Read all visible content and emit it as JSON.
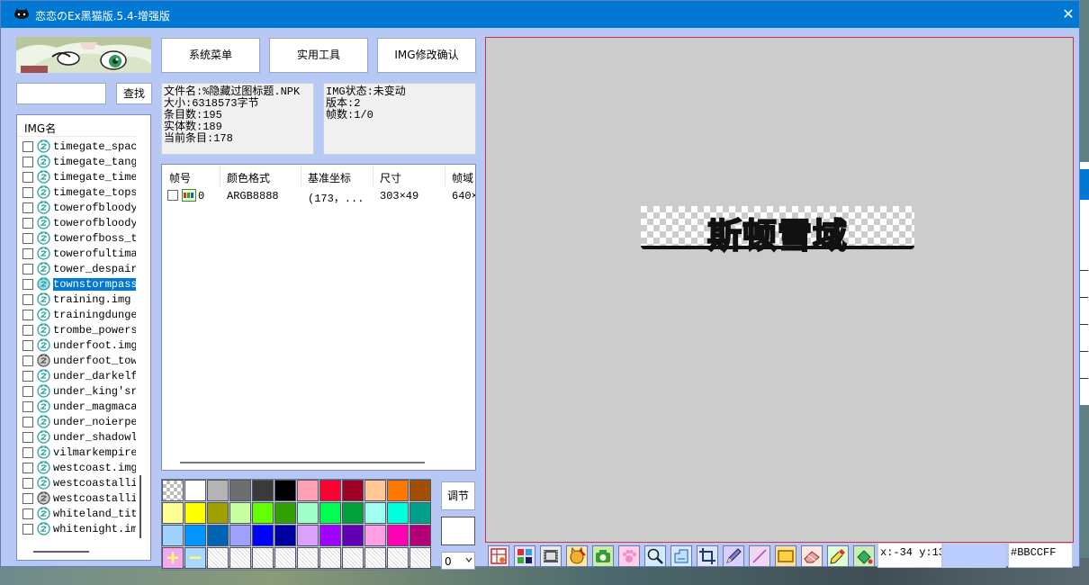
{
  "window": {
    "title": "恋恋のEx黑猫版.5.4-增强版"
  },
  "search": {
    "placeholder": "",
    "button": "查找"
  },
  "imglist": {
    "header": "IMG名",
    "items": [
      {
        "name": "timegate_spac",
        "icon": "ghost-icon"
      },
      {
        "name": "timegate_tang",
        "icon": "ghost-icon"
      },
      {
        "name": "timegate_time",
        "icon": "ghost-icon"
      },
      {
        "name": "timegate_tops",
        "icon": "ghost-icon"
      },
      {
        "name": "towerofbloody",
        "icon": "ghost-icon"
      },
      {
        "name": "towerofbloody",
        "icon": "ghost-icon"
      },
      {
        "name": "towerofboss_t",
        "icon": "ghost-icon"
      },
      {
        "name": "towerofultima",
        "icon": "ghost-icon"
      },
      {
        "name": "tower_despair",
        "icon": "ghost-icon"
      },
      {
        "name": "townstormpass",
        "icon": "ghost-icon-modified",
        "selected": true
      },
      {
        "name": "training.img",
        "icon": "ghost-icon"
      },
      {
        "name": "trainingdunge",
        "icon": "ghost-icon"
      },
      {
        "name": "trombe_powers",
        "icon": "ghost-icon"
      },
      {
        "name": "underfoot.img",
        "icon": "ghost-icon"
      },
      {
        "name": "underfoot_tow",
        "icon": "ghost-icon-gray"
      },
      {
        "name": "under_darkelf",
        "icon": "ghost-icon"
      },
      {
        "name": "under_king'sr",
        "icon": "ghost-icon"
      },
      {
        "name": "under_magmaca",
        "icon": "ghost-icon"
      },
      {
        "name": "under_noierpe",
        "icon": "ghost-icon"
      },
      {
        "name": "under_shadowl",
        "icon": "ghost-icon"
      },
      {
        "name": "vilmarkempire",
        "icon": "ghost-icon"
      },
      {
        "name": "westcoast.img",
        "icon": "ghost-icon"
      },
      {
        "name": "westcoastalli",
        "icon": "ghost-icon"
      },
      {
        "name": "westcoastalli",
        "icon": "ghost-icon-gray"
      },
      {
        "name": "whiteland_tit",
        "icon": "ghost-icon"
      },
      {
        "name": "whitenight.im",
        "icon": "ghost-icon"
      }
    ]
  },
  "toolbar": {
    "system_menu": "系统菜单",
    "tools": "实用工具",
    "img_confirm": "IMG修改确认"
  },
  "fileinfo": {
    "filename": "文件名:%隐藏过图标题.NPK",
    "size": "大小:6318573字节",
    "entries": "条目数:195",
    "entities": "实体数:189",
    "current": "当前条目:178"
  },
  "imginfo": {
    "status": "IMG状态:未变动",
    "version": "版本:2",
    "frames": "帧数:1/0"
  },
  "frametable": {
    "columns": [
      "帧号",
      "颜色格式",
      "基准坐标",
      "尺寸",
      "帧域"
    ],
    "rows": [
      {
        "index": "0",
        "format": "ARGB8888",
        "base": "(173，...",
        "size": "303×49",
        "domain": "640×"
      }
    ]
  },
  "palette": {
    "colors": [
      "transparent",
      "#ffffff",
      "#b4b4b4",
      "#6e6e6e",
      "#3a3a3a",
      "#000000",
      "#ffa0b4",
      "#ff0032",
      "#a00028",
      "#ffc896",
      "#ff7800",
      "#a05000",
      "#ffff96",
      "#ffff00",
      "#a0a000",
      "#c8ffa0",
      "#64ff00",
      "#32a000",
      "#a0ffc8",
      "#00ff50",
      "#00a03c",
      "#a0fff0",
      "#00ffdc",
      "#00a08c",
      "#a0d2ff",
      "#0096ff",
      "#0064b4",
      "#a0a0ff",
      "#0000ff",
      "#0000a0",
      "#dca0ff",
      "#a000ff",
      "#6400b4",
      "#ffa0e6",
      "#ff00b4",
      "#b40078"
    ],
    "add_symbol": "+",
    "remove_symbol": "−"
  },
  "side": {
    "adjust": "调节",
    "select_value": "0"
  },
  "canvas": {
    "sprite_text": "斯顿雪域"
  },
  "status": {
    "coord": "x:-34 y:13",
    "color_hex": "#BBCCFF",
    "preview_color": "#bbccff"
  },
  "tools": [
    "frame-grid-icon",
    "palette-icon",
    "film-icon",
    "cat-edit-icon",
    "camera-icon",
    "paw-icon",
    "magnifier-icon",
    "move-icon",
    "crop-icon",
    "pencil-icon",
    "line-icon",
    "rectangle-icon",
    "eraser-icon",
    "eyedropper-icon",
    "fill-icon"
  ]
}
